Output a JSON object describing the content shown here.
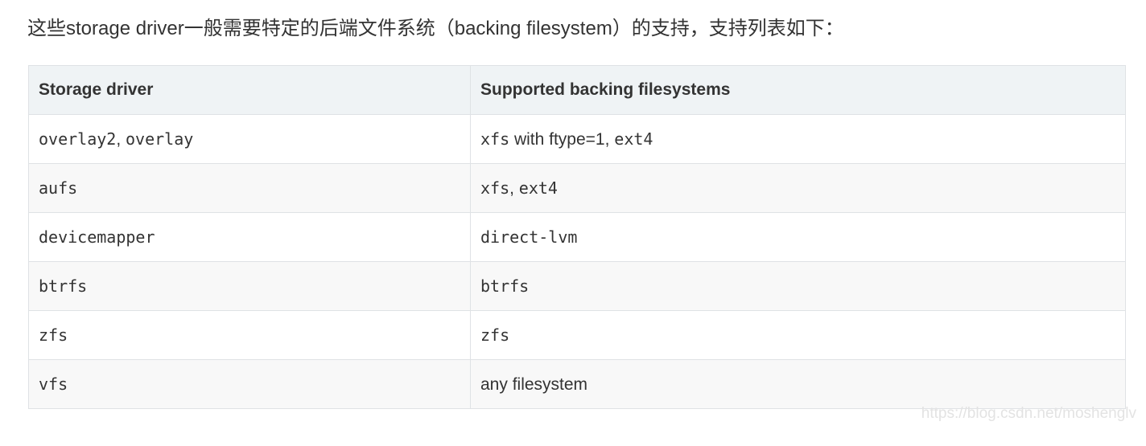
{
  "intro": "这些storage driver一般需要特定的后端文件系统（backing filesystem）的支持，支持列表如下：",
  "table": {
    "headers": [
      "Storage driver",
      "Supported backing filesystems"
    ],
    "rows": [
      {
        "driver": [
          {
            "t": "overlay2",
            "code": true
          },
          {
            "t": ", ",
            "code": false
          },
          {
            "t": "overlay",
            "code": true
          }
        ],
        "filesystems": [
          {
            "t": "xfs",
            "code": true
          },
          {
            "t": " with ftype=1, ",
            "code": false
          },
          {
            "t": "ext4",
            "code": true
          }
        ]
      },
      {
        "driver": [
          {
            "t": "aufs",
            "code": true
          }
        ],
        "filesystems": [
          {
            "t": "xfs",
            "code": true
          },
          {
            "t": ", ",
            "code": false
          },
          {
            "t": "ext4",
            "code": true
          }
        ]
      },
      {
        "driver": [
          {
            "t": "devicemapper",
            "code": true
          }
        ],
        "filesystems": [
          {
            "t": "direct-lvm",
            "code": true
          }
        ]
      },
      {
        "driver": [
          {
            "t": "btrfs",
            "code": true
          }
        ],
        "filesystems": [
          {
            "t": "btrfs",
            "code": true
          }
        ]
      },
      {
        "driver": [
          {
            "t": "zfs",
            "code": true
          }
        ],
        "filesystems": [
          {
            "t": "zfs",
            "code": true
          }
        ]
      },
      {
        "driver": [
          {
            "t": "vfs",
            "code": true
          }
        ],
        "filesystems": [
          {
            "t": "any filesystem",
            "code": false
          }
        ]
      }
    ]
  },
  "watermark": "https://blog.csdn.net/moshenglv",
  "colors": {
    "text": "#333333",
    "header_bg": "#eff3f5",
    "stripe_bg": "#f8f8f8",
    "border": "#dfe2e5"
  }
}
